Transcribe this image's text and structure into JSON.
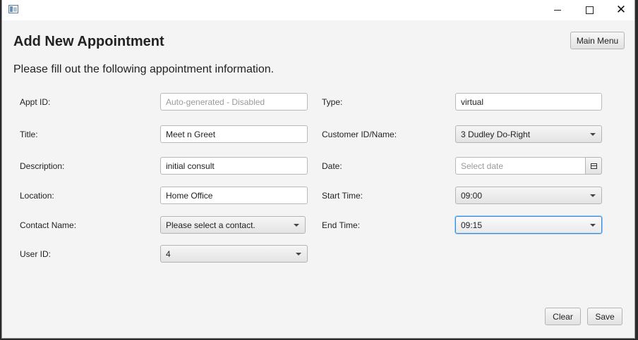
{
  "window": {
    "title": ""
  },
  "header": {
    "title": "Add New Appointment",
    "subtitle": "Please fill out the following appointment information.",
    "main_menu_label": "Main Menu"
  },
  "form": {
    "appt_id": {
      "label": "Appt ID:",
      "placeholder": "Auto-generated - Disabled",
      "value": ""
    },
    "title": {
      "label": "Title:",
      "value": "Meet n Greet"
    },
    "description": {
      "label": "Description:",
      "value": "initial consult"
    },
    "location": {
      "label": "Location:",
      "value": "Home Office"
    },
    "contact_name": {
      "label": "Contact Name:",
      "selected": "Please select a contact."
    },
    "user_id": {
      "label": "User ID:",
      "selected": "4"
    },
    "type": {
      "label": "Type:",
      "value": "virtual"
    },
    "customer": {
      "label": "Customer ID/Name:",
      "selected": "3 Dudley Do-Right"
    },
    "date": {
      "label": "Date:",
      "placeholder": "Select date",
      "value": ""
    },
    "start_time": {
      "label": "Start Time:",
      "selected": "09:00"
    },
    "end_time": {
      "label": "End Time:",
      "selected": "09:15"
    }
  },
  "actions": {
    "clear_label": "Clear",
    "save_label": "Save"
  },
  "icons": {
    "app": "app-window-icon",
    "calendar": "calendar-icon",
    "dropdown": "chevron-down-icon"
  }
}
